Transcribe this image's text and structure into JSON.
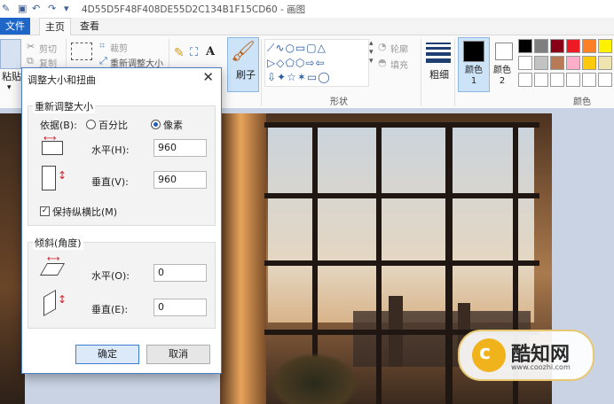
{
  "window": {
    "title": "4D55D5F48F408DE55D2C134B1F15CD60 - 画图"
  },
  "tabs": [
    {
      "label": "文件"
    },
    {
      "label": "主页"
    },
    {
      "label": "查看"
    }
  ],
  "ribbon": {
    "paste": "粘贴",
    "cut": "剪切",
    "copy": "复制",
    "crop": "裁剪",
    "resize": "重新调整大小",
    "brush": "刷子",
    "shapes_group": "形状",
    "outline": "轮廓",
    "fill": "填充",
    "size": "粗细",
    "color1": "颜色 1",
    "color2": "颜色 2",
    "colors_group": "颜色",
    "palette_row1": [
      "#000000",
      "#7f7f7f",
      "#880015",
      "#ed1c24",
      "#ff7f27",
      "#fff200"
    ],
    "palette_row2": [
      "#ffffff",
      "#c3c3c3",
      "#b97a57",
      "#ffaec9",
      "#ffc90e",
      "#efe4b0"
    ],
    "palette_row3": [
      "#ffffff",
      "#ffffff",
      "#ffffff",
      "#ffffff",
      "#ffffff",
      "#ffffff"
    ]
  },
  "dialog": {
    "title": "调整大小和扭曲",
    "resize_group": "重新调整大小",
    "by_label": "依据(B):",
    "percent_label": "百分比",
    "pixels_label": "像素",
    "horizontal_label": "水平(H):",
    "horizontal_value": "960",
    "vertical_label": "垂直(V):",
    "vertical_value": "960",
    "maintain_ratio": "保持纵横比(M)",
    "skew_group": "倾斜(角度)",
    "skew_h_label": "水平(O):",
    "skew_h_value": "0",
    "skew_v_label": "垂直(E):",
    "skew_v_value": "0",
    "ok": "确定",
    "cancel": "取消"
  },
  "watermark": {
    "name": "酷知网",
    "url": "www.coozhi.com"
  },
  "colors": {
    "accent": "#1e66c7",
    "dialog_border": "#4a7fc4"
  }
}
